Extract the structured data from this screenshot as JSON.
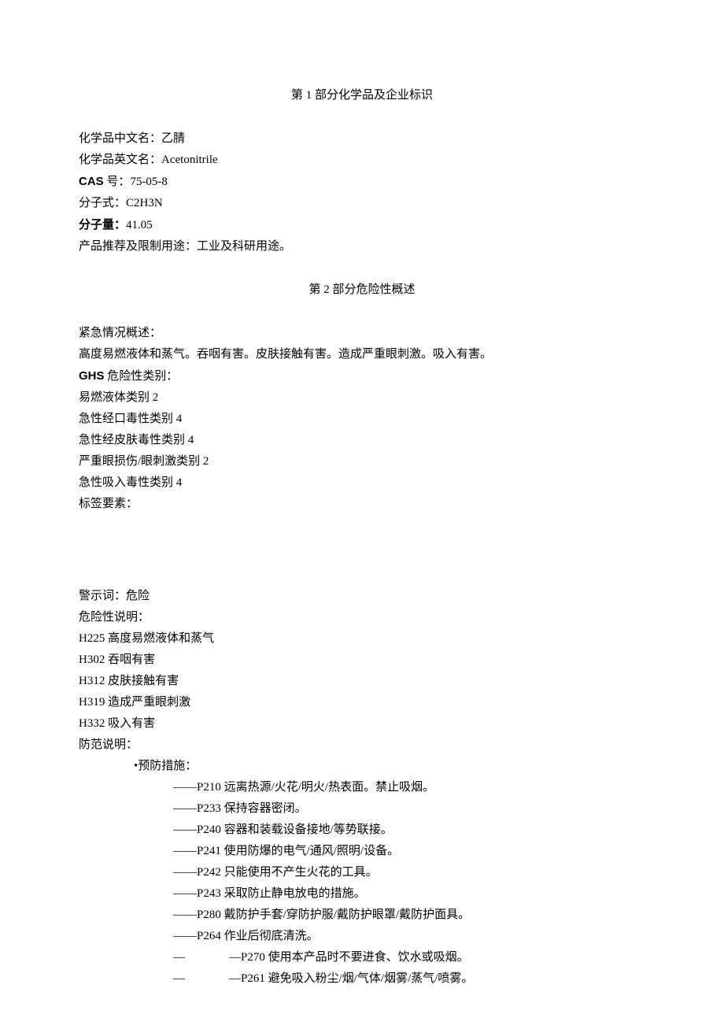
{
  "section1": {
    "title": "第 1 部分化学品及企业标识",
    "fields": {
      "chinese_name_label": "化学品中文名：",
      "chinese_name_value": "乙腈",
      "english_name_label": "化学品英文名：",
      "english_name_value": "Acetonitrile",
      "cas_label": "CAS",
      "cas_suffix": " 号：",
      "cas_value": "75-05-8",
      "formula_label": "分子式：",
      "formula_value": "C2H3N",
      "mw_label": "分子量：",
      "mw_value": "41.05",
      "usage_label": "产品推荐及限制用途：",
      "usage_value": "工业及科研用途。"
    }
  },
  "section2": {
    "title": "第 2 部分危险性概述",
    "emergency_label": "紧急情况概述：",
    "emergency_text": "高度易燃液体和蒸气。吞咽有害。皮肤接触有害。造成严重眼刺激。吸入有害。",
    "ghs_label": "GHS",
    "ghs_suffix": " 危险性类别：",
    "ghs_categories": [
      "易燃液体类别 2",
      "急性经口毒性类别 4",
      "急性经皮肤毒性类别 4",
      "严重眼损伤/眼刺激类别 2",
      "急性吸入毒性类别 4"
    ],
    "label_elements": "标签要素：",
    "signal_word_label": "警示词：",
    "signal_word_value": "危险",
    "hazard_statement_label": "危险性说明：",
    "hazard_statements": [
      "H225 高度易燃液体和蒸气",
      "H302 吞咽有害",
      "H312 皮肤接触有害",
      "H319 造成严重眼刺激",
      "H332 吸入有害"
    ],
    "precaution_label": "防范说明：",
    "prevention_heading": "•预防措施：",
    "prevention_items": [
      "——P210 远离热源/火花/明火/热表面。禁止吸烟。",
      "——P233 保持容器密闭。",
      "——P240 容器和装载设备接地/等势联接。",
      "——P241 使用防爆的电气/通风/照明/设备。",
      "——P242 只能使用不产生火花的工具。",
      "——P243 采取防止静电放电的措施。",
      "——P280 戴防护手套/穿防护服/戴防护眼罩/戴防护面具。",
      "——P264 作业后彻底清洗。"
    ],
    "prevention_items_spaced": [
      {
        "dash": "—",
        "rest": "—P270 使用本产品时不要进食、饮水或吸烟。"
      },
      {
        "dash": "—",
        "rest": "—P261 避免吸入粉尘/烟/气体/烟雾/蒸气/喷雾。"
      }
    ]
  }
}
